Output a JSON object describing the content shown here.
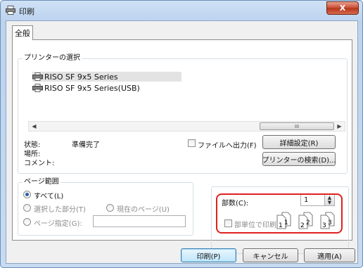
{
  "window": {
    "title": "印刷",
    "close_label": "X"
  },
  "tab": {
    "label": "全般"
  },
  "printer_select": {
    "legend": "プリンターの選択",
    "printers": [
      "RISO SF 9x5 Series",
      "RISO SF 9x5 Series(USB)"
    ],
    "scroll_thumb": "III"
  },
  "status": {
    "state_label": "状態:",
    "state_value": "準備完了",
    "location_label": "場所:",
    "comment_label": "コメント:",
    "print_to_file": "ファイルへ出力(F)",
    "preferences_button": "詳細設定(R)",
    "find_printer_button": "プリンターの検索(D)..."
  },
  "page_range": {
    "legend": "ページ範囲",
    "all": "すべて(L)",
    "selection": "選択した部分(T)",
    "current_page": "現在のページ(U)",
    "pages": "ページ指定(G):",
    "pages_value": ""
  },
  "copies": {
    "label": "部数(C):",
    "value": "1",
    "collate": "部単位で印刷(O)",
    "collate_pages": [
      "1",
      "1",
      "2",
      "2",
      "3",
      "3"
    ]
  },
  "buttons": {
    "print": "印刷(P)",
    "cancel": "キャンセル",
    "apply": "適用(A)"
  },
  "colors": {
    "highlight": "#e02020",
    "title_gradient": "#bcd3ee",
    "close": "#c74a30"
  }
}
